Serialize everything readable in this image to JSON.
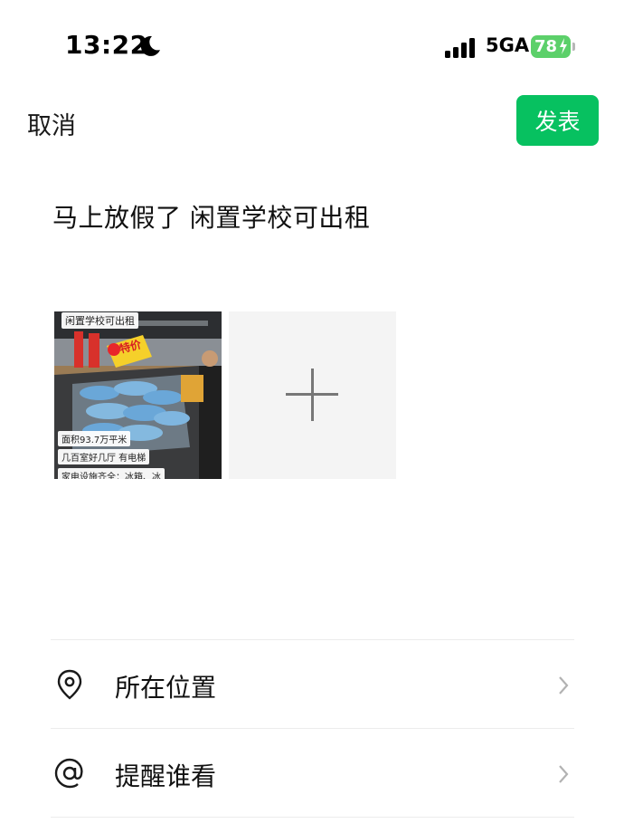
{
  "status_bar": {
    "time": "13:22",
    "network": "5GA",
    "battery": "78"
  },
  "nav": {
    "cancel_label": "取消",
    "publish_label": "发表"
  },
  "post": {
    "text": "马上放假了 闲置学校可出租"
  },
  "image_thumb": {
    "overlay_title": "闲置学校可出租",
    "badge": "特价",
    "area_text": "面积93.7万平米",
    "rooms_text": "几百室好几厅 有电梯",
    "appliances_text": "家电设施齐全：冰箱、冰"
  },
  "options": [
    {
      "label": "所在位置",
      "icon": "location-pin-icon"
    },
    {
      "label": "提醒谁看",
      "icon": "at-sign-icon"
    }
  ],
  "colors": {
    "accent": "#07c160",
    "battery": "#5cd06a"
  }
}
